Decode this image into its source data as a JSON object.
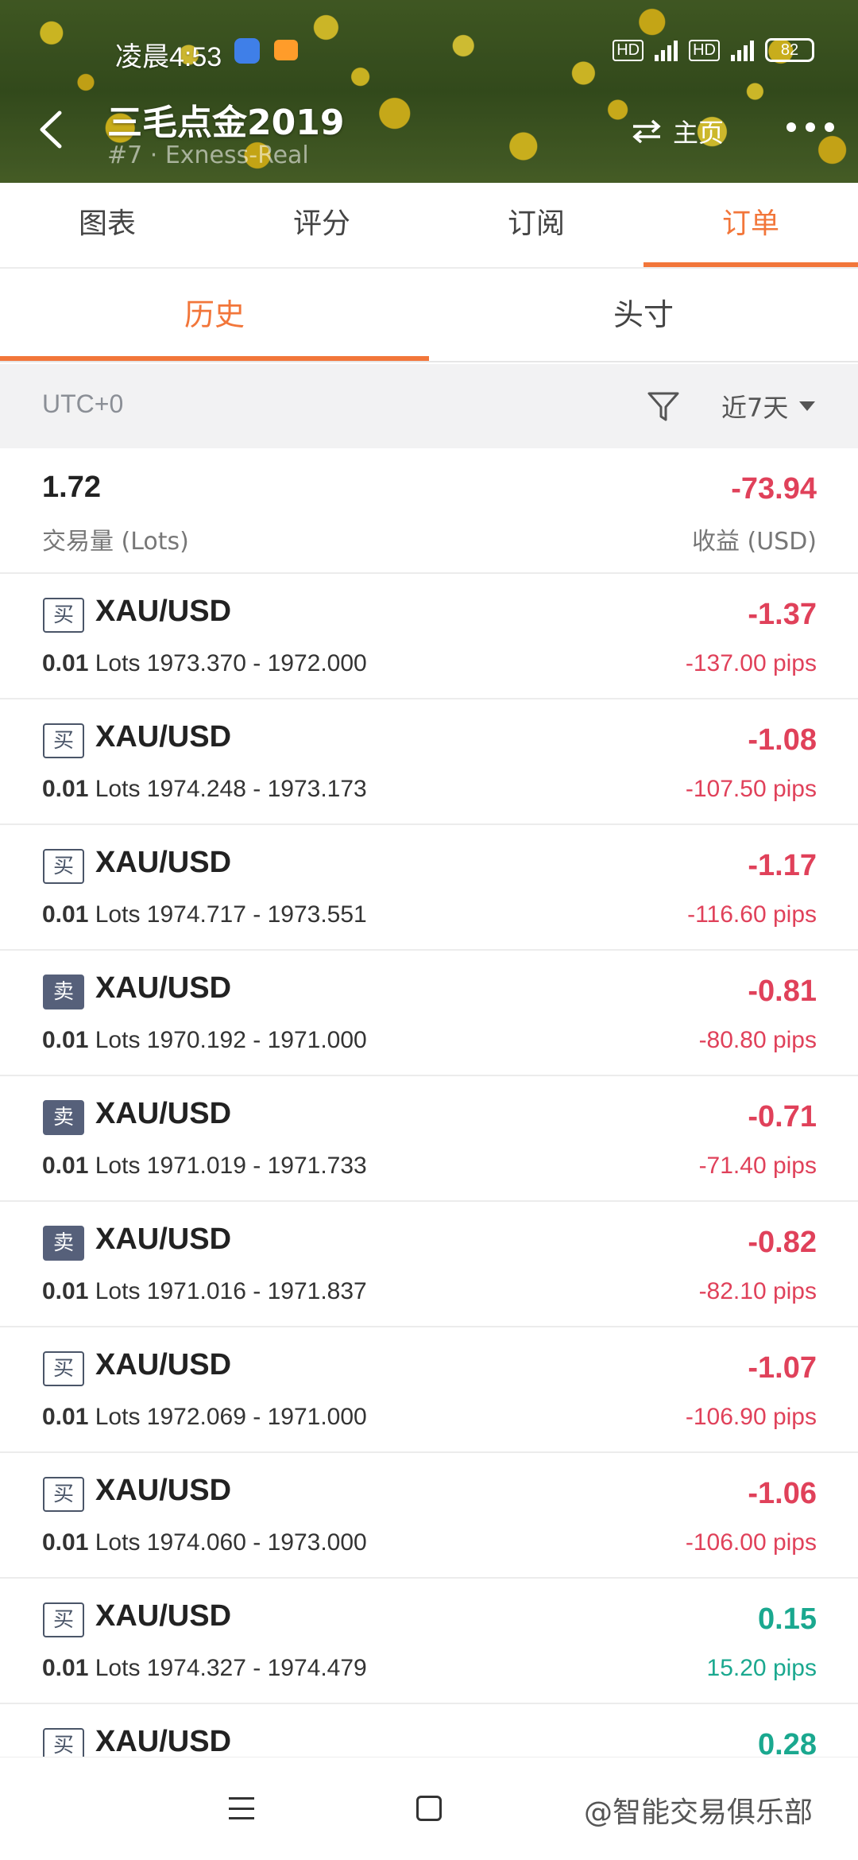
{
  "status": {
    "time": "凌晨4:53",
    "net1": "HD",
    "net1_type": "4G",
    "net2": "HD",
    "net2_type": "4G",
    "battery": "82"
  },
  "header": {
    "title": "三毛点金2019",
    "subtitle": "#7 · Exness-Real",
    "home_label": "主页"
  },
  "main_tabs": [
    "图表",
    "评分",
    "订阅",
    "订单"
  ],
  "sub_tabs": [
    "历史",
    "头寸"
  ],
  "filter": {
    "timezone": "UTC+0",
    "range": "近7天"
  },
  "summary": {
    "volume": "1.72",
    "volume_label": "交易量 (Lots)",
    "pnl": "-73.94",
    "pnl_label": "收益 (USD)"
  },
  "orders": [
    {
      "side": "买",
      "symbol": "XAU/USD",
      "lots": "0.01",
      "unit": "Lots",
      "prices": "1973.370 - 1972.000",
      "pnl": "-1.37",
      "pips": "-137.00 pips"
    },
    {
      "side": "买",
      "symbol": "XAU/USD",
      "lots": "0.01",
      "unit": "Lots",
      "prices": "1974.248 - 1973.173",
      "pnl": "-1.08",
      "pips": "-107.50 pips"
    },
    {
      "side": "买",
      "symbol": "XAU/USD",
      "lots": "0.01",
      "unit": "Lots",
      "prices": "1974.717 - 1973.551",
      "pnl": "-1.17",
      "pips": "-116.60 pips"
    },
    {
      "side": "卖",
      "symbol": "XAU/USD",
      "lots": "0.01",
      "unit": "Lots",
      "prices": "1970.192 - 1971.000",
      "pnl": "-0.81",
      "pips": "-80.80 pips"
    },
    {
      "side": "卖",
      "symbol": "XAU/USD",
      "lots": "0.01",
      "unit": "Lots",
      "prices": "1971.019 - 1971.733",
      "pnl": "-0.71",
      "pips": "-71.40 pips"
    },
    {
      "side": "卖",
      "symbol": "XAU/USD",
      "lots": "0.01",
      "unit": "Lots",
      "prices": "1971.016 - 1971.837",
      "pnl": "-0.82",
      "pips": "-82.10 pips"
    },
    {
      "side": "买",
      "symbol": "XAU/USD",
      "lots": "0.01",
      "unit": "Lots",
      "prices": "1972.069 - 1971.000",
      "pnl": "-1.07",
      "pips": "-106.90 pips"
    },
    {
      "side": "买",
      "symbol": "XAU/USD",
      "lots": "0.01",
      "unit": "Lots",
      "prices": "1974.060 - 1973.000",
      "pnl": "-1.06",
      "pips": "-106.00 pips"
    },
    {
      "side": "买",
      "symbol": "XAU/USD",
      "lots": "0.01",
      "unit": "Lots",
      "prices": "1974.327 - 1974.479",
      "pnl": "0.15",
      "pips": "15.20 pips"
    },
    {
      "side": "买",
      "symbol": "XAU/USD",
      "lots": "",
      "unit": "",
      "prices": "",
      "pnl": "0.28",
      "pips": ""
    }
  ],
  "watermark": "@智能交易俱乐部",
  "colors": {
    "accent": "#f2763a",
    "loss": "#e0415a",
    "profit": "#1aa88f",
    "sell_badge": "#56607a"
  }
}
